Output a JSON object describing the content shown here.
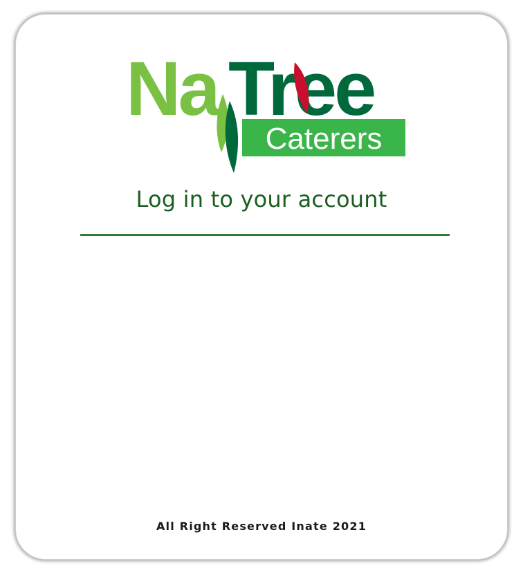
{
  "brand": {
    "logo_part1": "Na",
    "logo_part2": "Tree",
    "logo_subtitle": "Caterers"
  },
  "login": {
    "heading": "Log in to your account"
  },
  "footer": {
    "text": "All Right Reserved Inate 2021"
  },
  "colors": {
    "light_green": "#7ac143",
    "dark_green": "#00693c",
    "accent_red": "#c8102e",
    "heading_green": "#1b5e20",
    "divider_green": "#2e7d32"
  }
}
